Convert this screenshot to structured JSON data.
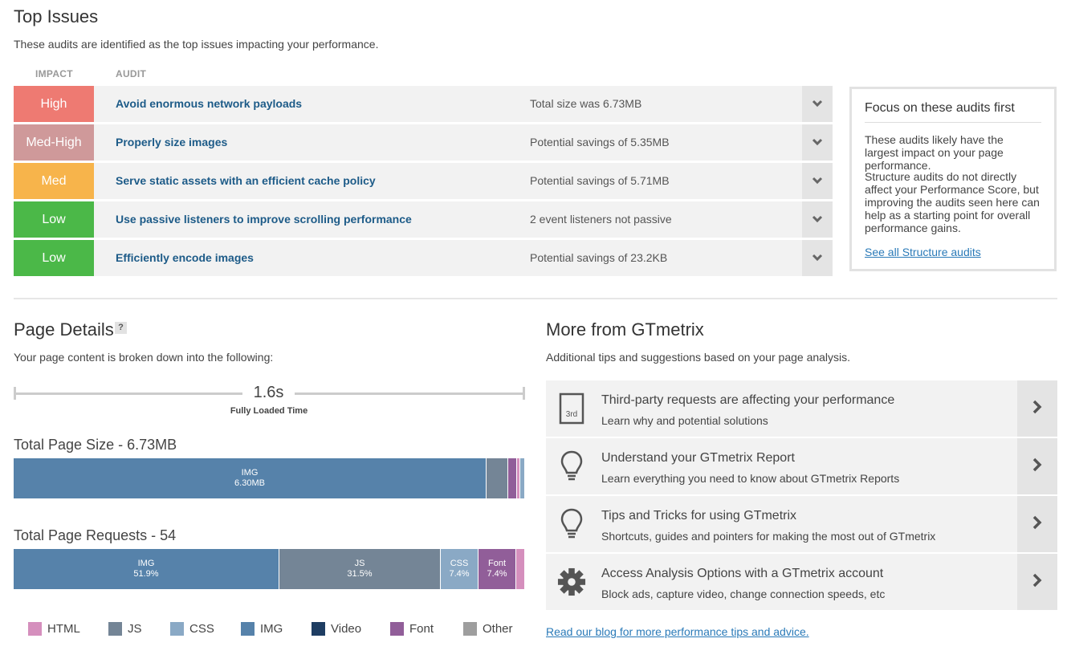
{
  "top_issues": {
    "title": "Top Issues",
    "subtitle": "These audits are identified as the top issues impacting your performance.",
    "col_impact": "IMPACT",
    "col_audit": "AUDIT",
    "rows": [
      {
        "impact": "High",
        "color": "#ee7a72",
        "audit": "Avoid enormous network payloads",
        "detail": "Total size was 6.73MB"
      },
      {
        "impact": "Med-High",
        "color": "#cf999a",
        "audit": "Properly size images",
        "detail": "Potential savings of 5.35MB"
      },
      {
        "impact": "Med",
        "color": "#f7b44b",
        "audit": "Serve static assets with an efficient cache policy",
        "detail": "Potential savings of 5.71MB"
      },
      {
        "impact": "Low",
        "color": "#4bb848",
        "audit": "Use passive listeners to improve scrolling performance",
        "detail": "2 event listeners not passive"
      },
      {
        "impact": "Low",
        "color": "#4bb848",
        "audit": "Efficiently encode images",
        "detail": "Potential savings of 23.2KB"
      }
    ]
  },
  "focus_box": {
    "title": "Focus on these audits first",
    "para1": "These audits likely have the largest impact on your page performance.",
    "para2": "Structure audits do not directly affect your Performance Score, but improving the audits seen here can help as a starting point for overall performance gains.",
    "link": "See all Structure audits"
  },
  "page_details": {
    "title": "Page Details",
    "help": "?",
    "subtitle": "Your page content is broken down into the following:",
    "load_time": "1.6s",
    "load_label": "Fully Loaded Time",
    "size_title": "Total Page Size - 6.73MB",
    "requests_title": "Total Page Requests - 54",
    "size_bar": [
      {
        "name": "IMG",
        "value": "6.30MB",
        "fraction": 0.925,
        "color": "#5682aa"
      },
      {
        "name": "JS",
        "value": "",
        "fraction": 0.042,
        "color": "#748596"
      },
      {
        "name": "Font",
        "value": "",
        "fraction": 0.018,
        "color": "#915e99"
      },
      {
        "name": "HTML",
        "value": "",
        "fraction": 0.006,
        "color": "#d58fbd"
      },
      {
        "name": "CSS",
        "value": "",
        "fraction": 0.009,
        "color": "#8aa9c5"
      }
    ],
    "requests_bar": [
      {
        "name": "IMG",
        "value": "51.9%",
        "fraction": 0.519,
        "color": "#5682aa"
      },
      {
        "name": "JS",
        "value": "31.5%",
        "fraction": 0.315,
        "color": "#748596"
      },
      {
        "name": "CSS",
        "value": "7.4%",
        "fraction": 0.074,
        "color": "#8aa9c5"
      },
      {
        "name": "Font",
        "value": "7.4%",
        "fraction": 0.074,
        "color": "#915e99"
      },
      {
        "name": "HTML",
        "value": "",
        "fraction": 0.018,
        "color": "#d58fbd"
      }
    ],
    "legend": [
      {
        "label": "HTML",
        "color": "#d58fbd"
      },
      {
        "label": "JS",
        "color": "#748596"
      },
      {
        "label": "CSS",
        "color": "#8aa9c5"
      },
      {
        "label": "IMG",
        "color": "#5682aa"
      },
      {
        "label": "Video",
        "color": "#1e3d62"
      },
      {
        "label": "Font",
        "color": "#915e99"
      },
      {
        "label": "Other",
        "color": "#9e9e9e"
      }
    ]
  },
  "more": {
    "title": "More from GTmetrix",
    "subtitle": "Additional tips and suggestions based on your page analysis.",
    "items": [
      {
        "icon": "third-party-icon",
        "icon_text": "3rd",
        "title": "Third-party requests are affecting your performance",
        "desc": "Learn why and potential solutions"
      },
      {
        "icon": "lightbulb-icon",
        "title": "Understand your GTmetrix Report",
        "desc": "Learn everything you need to know about GTmetrix Reports"
      },
      {
        "icon": "lightbulb-icon",
        "title": "Tips and Tricks for using GTmetrix",
        "desc": "Shortcuts, guides and pointers for making the most out of GTmetrix"
      },
      {
        "icon": "gear-icon",
        "title": "Access Analysis Options with a GTmetrix account",
        "desc": "Block ads, capture video, change connection speeds, etc"
      }
    ],
    "blog_link": "Read our blog for more performance tips and advice."
  }
}
